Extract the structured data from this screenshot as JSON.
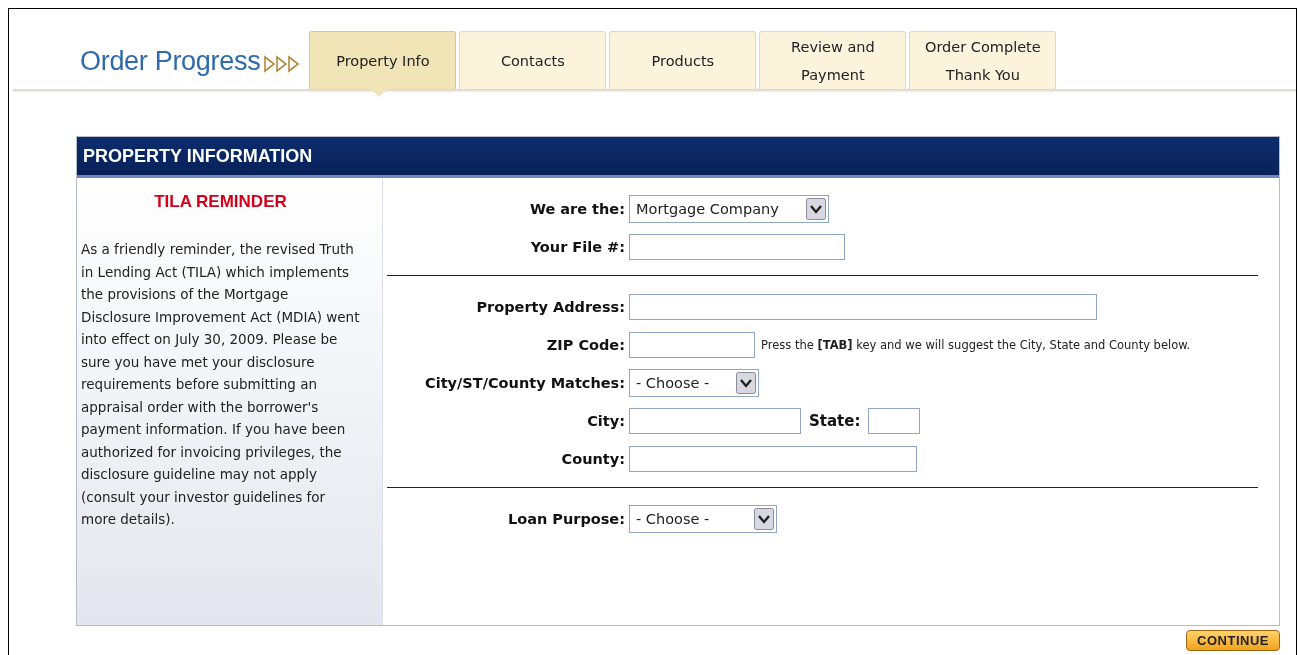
{
  "progress": {
    "title": "Order Progress",
    "tabs": [
      {
        "label": "Property Info",
        "selected": true
      },
      {
        "label": "Contacts",
        "selected": false
      },
      {
        "label": "Products",
        "selected": false
      },
      {
        "label": "Review and Payment",
        "selected": false
      },
      {
        "label": "Order Complete Thank You",
        "selected": false
      }
    ]
  },
  "panel": {
    "title": "PROPERTY INFORMATION",
    "reminder": {
      "title": "TILA REMINDER",
      "text": "As a friendly reminder, the revised Truth in Lending Act (TILA) which implements the provisions of the Mortgage Disclosure Improvement Act (MDIA) went into effect on July 30, 2009. Please be sure you have met your disclosure requirements before submitting an appraisal order with the borrower's payment information. If you have been authorized for invoicing privileges, the disclosure guideline may not apply (consult your investor guidelines for more details)."
    },
    "sections": [
      {
        "rows": [
          {
            "label": "We are the:",
            "fields": [
              {
                "kind": "select",
                "value": "Mortgage Company"
              }
            ]
          },
          {
            "label": "Your File #:",
            "fields": [
              {
                "kind": "text"
              }
            ]
          }
        ]
      },
      {
        "rows": [
          {
            "label": "Property Address:",
            "fields": [
              {
                "kind": "text"
              }
            ]
          },
          {
            "label": "ZIP Code:",
            "fields": [
              {
                "kind": "text"
              }
            ],
            "hint": "Press the **[TAB]** key and we will suggest the City, State and County below."
          },
          {
            "label": "City/ST/County Matches:",
            "fields": [
              {
                "kind": "select",
                "value": "- Choose -"
              }
            ]
          },
          {
            "label": "City:",
            "fields": [
              {
                "kind": "text"
              },
              {
                "kind": "text",
                "label": "State:"
              }
            ]
          },
          {
            "label": "County:",
            "fields": [
              {
                "kind": "text"
              }
            ]
          }
        ]
      },
      {
        "rows": [
          {
            "label": "Loan Purpose:",
            "fields": [
              {
                "kind": "select",
                "value": "- Choose -"
              }
            ]
          }
        ]
      }
    ]
  },
  "continue_button": "CONTINUE"
}
